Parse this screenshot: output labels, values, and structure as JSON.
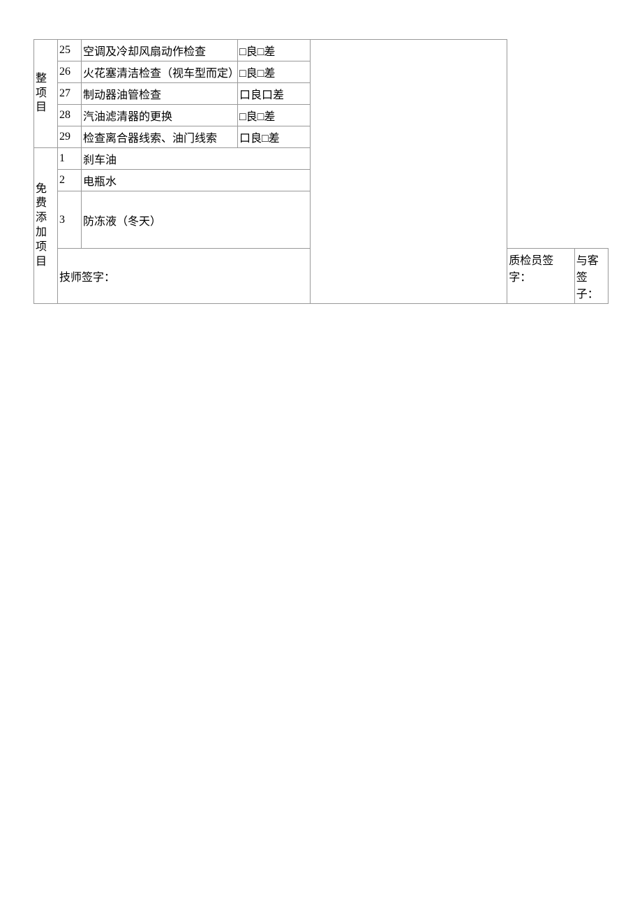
{
  "groups": {
    "adjustment": "整项目",
    "free_add": "免费添加项目"
  },
  "eval": {
    "good": "良",
    "bad": "差",
    "box": "□"
  },
  "adjustment_items": [
    {
      "num": "25",
      "desc": "空调及冷却风扇动作检查",
      "eval": "□良□差"
    },
    {
      "num": "26",
      "desc": "火花塞清洁检查（视车型而定）",
      "eval": "□良□差"
    },
    {
      "num": "27",
      "desc": "制动器油管检查",
      "eval": "口良口差"
    },
    {
      "num": "28",
      "desc": "汽油滤清器的更换",
      "eval": "□良□差"
    },
    {
      "num": "29",
      "desc": "检查离合器线索、油门线索",
      "eval": "口良□差"
    }
  ],
  "free_add_items": [
    {
      "num": "1",
      "desc": "刹车油"
    },
    {
      "num": "2",
      "desc": "电瓶水"
    },
    {
      "num": "3",
      "desc": "防冻液（冬天）"
    }
  ],
  "signatures": {
    "tech": "技师签字：",
    "qc": "质检员签字：",
    "customer_line1": "与客签",
    "customer_line2": "子："
  }
}
